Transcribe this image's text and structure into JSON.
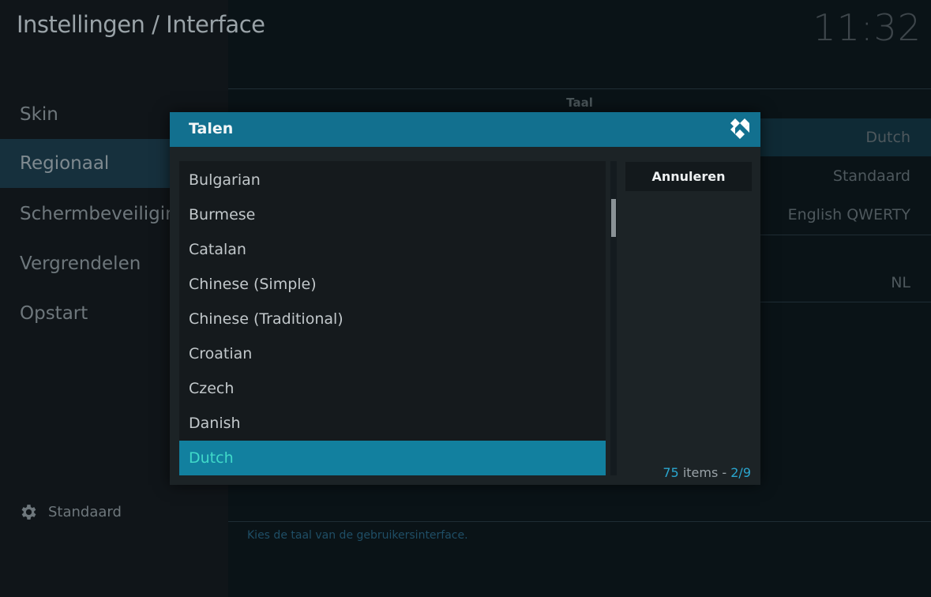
{
  "header": {
    "title": "Instellingen / Interface",
    "clock": "11:32"
  },
  "sidebar": {
    "items": [
      {
        "label": "Skin",
        "active": false
      },
      {
        "label": "Regionaal",
        "active": true
      },
      {
        "label": "Schermbeveiliging",
        "active": false
      },
      {
        "label": "Vergrendelen",
        "active": false
      },
      {
        "label": "Opstart",
        "active": false
      }
    ],
    "footer": {
      "icon": "gear-icon",
      "label": "Standaard"
    }
  },
  "settings": {
    "section_label": "Taal",
    "values": [
      "Dutch",
      "Standaard",
      "English QWERTY",
      "NL"
    ],
    "hint": "Kies de taal van de gebruikersinterface."
  },
  "dialog": {
    "title": "Talen",
    "logo_icon": "kodi-logo-icon",
    "items": [
      "Bulgarian",
      "Burmese",
      "Catalan",
      "Chinese (Simple)",
      "Chinese (Traditional)",
      "Croatian",
      "Czech",
      "Danish",
      "Dutch"
    ],
    "selected": "Dutch",
    "cancel_label": "Annuleren",
    "count": {
      "total": "75",
      "items_word": " items - ",
      "page": "2/9"
    }
  },
  "colors": {
    "accent": "#12708f",
    "selection": "#12809f",
    "selected_text": "#40d9c9"
  }
}
